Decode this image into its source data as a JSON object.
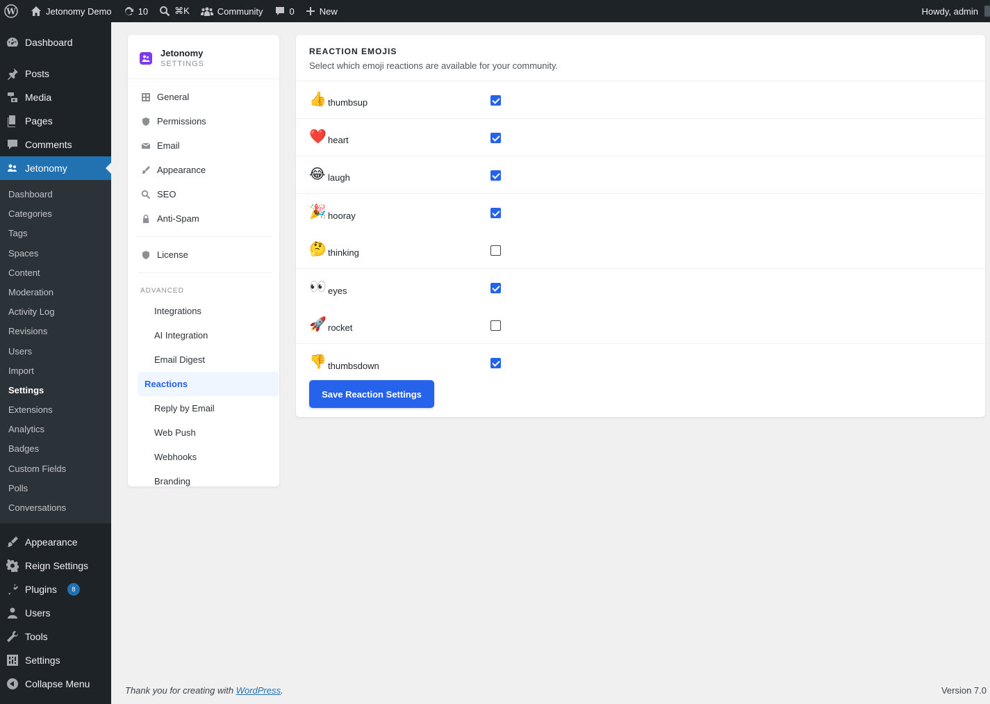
{
  "adminbar": {
    "site_name": "Jetonomy Demo",
    "updates_count": "10",
    "search_shortcut": "⌘K",
    "community_label": "Community",
    "comments_count": "0",
    "new_label": "New",
    "greeting": "Howdy, admin"
  },
  "menu": {
    "top_items": [
      {
        "label": "Dashboard",
        "icon": "dashboard-icon"
      },
      {
        "label": "Posts",
        "icon": "pin-icon"
      },
      {
        "label": "Media",
        "icon": "media-icon"
      },
      {
        "label": "Pages",
        "icon": "pages-icon"
      },
      {
        "label": "Comments",
        "icon": "comments-icon"
      },
      {
        "label": "Jetonomy",
        "icon": "jetonomy-icon"
      }
    ],
    "jetonomy_sub": [
      "Dashboard",
      "Categories",
      "Tags",
      "Spaces",
      "Content",
      "Moderation",
      "Activity Log",
      "Revisions",
      "Users",
      "Import",
      "Settings",
      "Extensions",
      "Analytics",
      "Badges",
      "Custom Fields",
      "Polls",
      "Conversations"
    ],
    "bottom_items": [
      {
        "label": "Appearance"
      },
      {
        "label": "Reign Settings"
      },
      {
        "label": "Plugins",
        "badge": "8"
      },
      {
        "label": "Users"
      },
      {
        "label": "Tools"
      },
      {
        "label": "Settings"
      },
      {
        "label": "Collapse Menu"
      }
    ]
  },
  "settings_nav": {
    "brand": "Jetonomy",
    "brand_sub": "SETTINGS",
    "items": [
      "General",
      "Permissions",
      "Email",
      "Appearance",
      "SEO",
      "Anti-Spam"
    ],
    "license": "License",
    "advanced_heading": "ADVANCED",
    "advanced_items": [
      "Integrations",
      "AI Integration",
      "Email Digest",
      "Reactions",
      "Reply by Email",
      "Web Push",
      "Webhooks",
      "Branding"
    ]
  },
  "panel": {
    "title": "REACTION EMOJIS",
    "description": "Select which emoji reactions are available for your community.",
    "reactions": [
      {
        "emoji": "👍",
        "name": "thumbsup",
        "enabled": true
      },
      {
        "emoji": "❤️",
        "name": "heart",
        "enabled": true
      },
      {
        "emoji": "😂",
        "name": "laugh",
        "enabled": true
      },
      {
        "emoji": "🎉",
        "name": "hooray",
        "enabled": true
      },
      {
        "emoji": "🤔",
        "name": "thinking",
        "enabled": false
      },
      {
        "emoji": "👀",
        "name": "eyes",
        "enabled": true
      },
      {
        "emoji": "🚀",
        "name": "rocket",
        "enabled": false
      },
      {
        "emoji": "👎",
        "name": "thumbsdown",
        "enabled": true
      }
    ],
    "save_label": "Save Reaction Settings"
  },
  "footer": {
    "thanks_prefix": "Thank you for creating with ",
    "thanks_link": "WordPress",
    "thanks_suffix": ".",
    "version": "Version 7.0"
  }
}
